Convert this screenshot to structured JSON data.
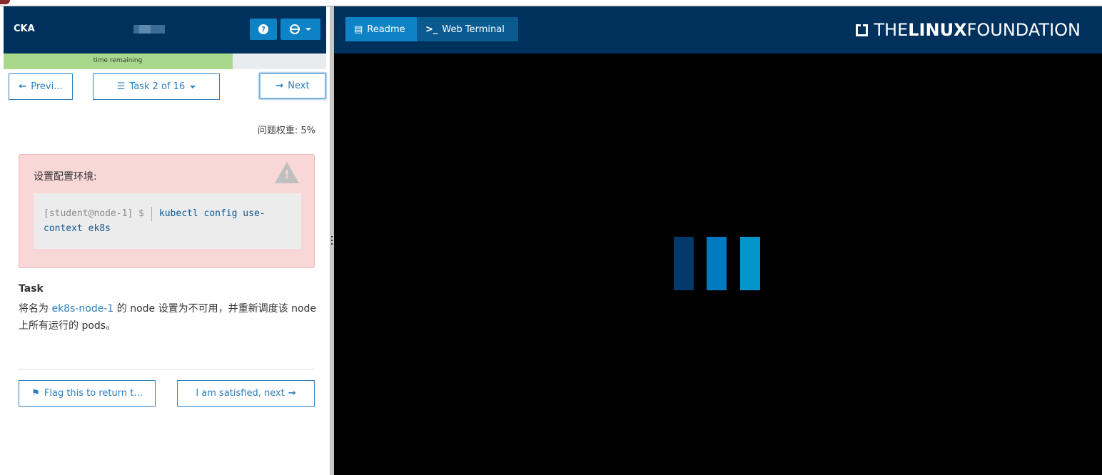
{
  "exam": {
    "title": "CKA",
    "help_icon": "question-circle-icon",
    "lang_icon": "globe-icon",
    "time_label": "time remaining",
    "time_fraction": 0.71
  },
  "nav": {
    "prev_label": "Previ...",
    "task_label": "Task 2 of 16",
    "next_label": "Next"
  },
  "question_weight": "问题权重: 5%",
  "alert": {
    "title": "设置配置环境:",
    "prompt": "[student@node-1] $",
    "command": "kubectl config use-context ek8s"
  },
  "task": {
    "label": "Task",
    "desc_pre": "将名为",
    "desc_node": "ek8s-node-1",
    "desc_post": "的 node 设置为不可用，并重新调度该 node 上所有运行的 pods。"
  },
  "actions": {
    "flag_label": "Flag this to return t...",
    "satisfied_label": "I am satisfied, next"
  },
  "right": {
    "readme_tab": "Readme",
    "terminal_tab": "Web Terminal",
    "logo_the": "THE",
    "logo_linux": "LINUX",
    "logo_foundation": "FOUNDATION",
    "loader_colors": [
      "#013a6b",
      "#0079c1",
      "#0195c9"
    ]
  }
}
